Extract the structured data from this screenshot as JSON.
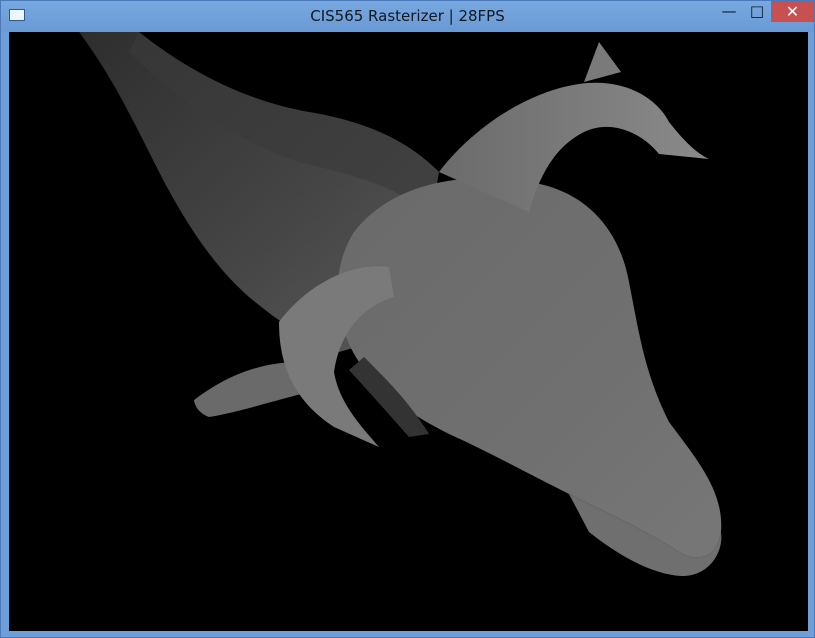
{
  "window": {
    "title": "CIS565 Rasterizer | 28FPS",
    "controls": {
      "minimize": "—",
      "maximize": "□",
      "close": "✕"
    }
  },
  "icons": {
    "app": "application-icon",
    "minimize": "minimize-icon",
    "maximize": "maximize-icon",
    "close": "close-icon"
  },
  "render": {
    "background": "#000000",
    "model": "cow",
    "shading": "gray"
  },
  "colors": {
    "titlebar": "#6f9fd8",
    "close": "#c75050"
  }
}
